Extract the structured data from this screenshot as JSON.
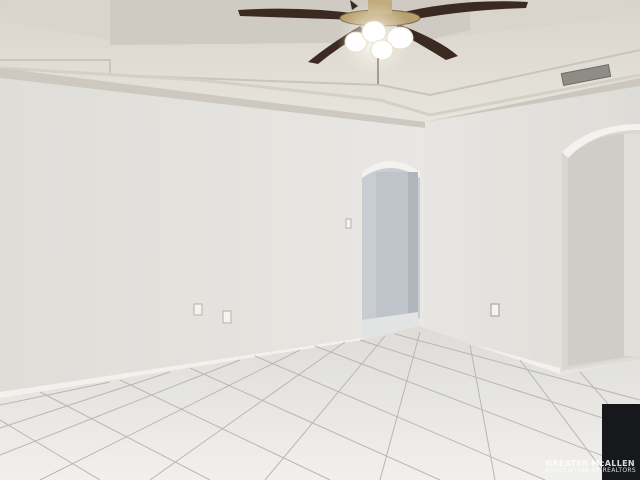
{
  "scene": {
    "subject": "room",
    "colors": {
      "wall": "#e6e4df",
      "wall_shadow": "#d6d3cc",
      "ceiling": "#e9e6df",
      "floor_tile": "#ecebe8",
      "grout": "#bdbab5",
      "fan_blade": "#3a2a22",
      "light_glow": "#fff8e6"
    }
  },
  "watermark": {
    "line1": "GREATER McALLEN",
    "line2": "ASSOCIATION OF REALTORS"
  }
}
